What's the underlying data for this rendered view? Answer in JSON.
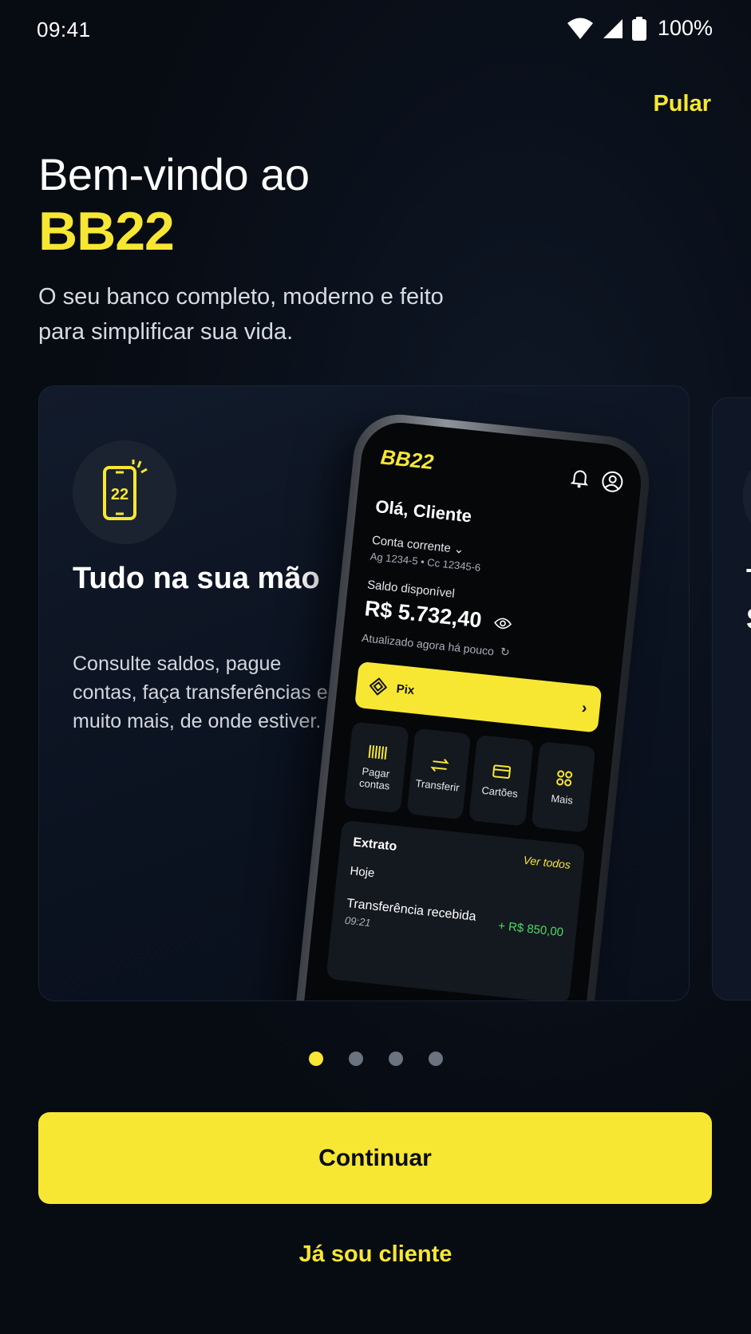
{
  "status_bar": {
    "time": "09:41",
    "battery": "100%"
  },
  "header": {
    "skip_label": "Pular"
  },
  "hero": {
    "title_line1": "Bem-vindo ao",
    "brand": "BB22",
    "subtitle": "O seu banco completo, moderno e feito para simplificar sua vida."
  },
  "carousel": {
    "active_index": 0,
    "page_count": 4,
    "card": {
      "icon": "phone-22-icon",
      "title": "Tudo na sua mão",
      "description": "Consulte saldos, pague contas, faça transferências e muito mais, de onde estiver."
    },
    "next_card_peek": {
      "title_initial": "T",
      "title_initial2": "S"
    }
  },
  "mock_app": {
    "logo": "BB22",
    "greeting": "Olá, Cliente",
    "account_type": "Conta corrente",
    "agency": "Ag 1234-5",
    "account_number": "Cc 12345-6",
    "balance_label": "Saldo disponível",
    "balance": "R$ 5.732,40",
    "updated": "Atualizado agora há pouco",
    "pix_label": "Pix",
    "actions": [
      {
        "label": "Pagar contas",
        "icon": "barcode-icon"
      },
      {
        "label": "Transferir",
        "icon": "transfer-icon"
      },
      {
        "label": "Cartões",
        "icon": "card-icon"
      },
      {
        "label": "Mais",
        "icon": "grid-icon"
      }
    ],
    "statement": {
      "title": "Extrato",
      "see_all": "Ver todos",
      "day": "Hoje",
      "transaction": {
        "name": "Transferência recebida",
        "time": "09:21",
        "amount": "+ R$ 850,00"
      }
    }
  },
  "buttons": {
    "continue": "Continuar",
    "already_client": "Já sou cliente"
  },
  "colors": {
    "accent": "#f7e733",
    "background": "#070b12",
    "positive": "#4cd964"
  }
}
